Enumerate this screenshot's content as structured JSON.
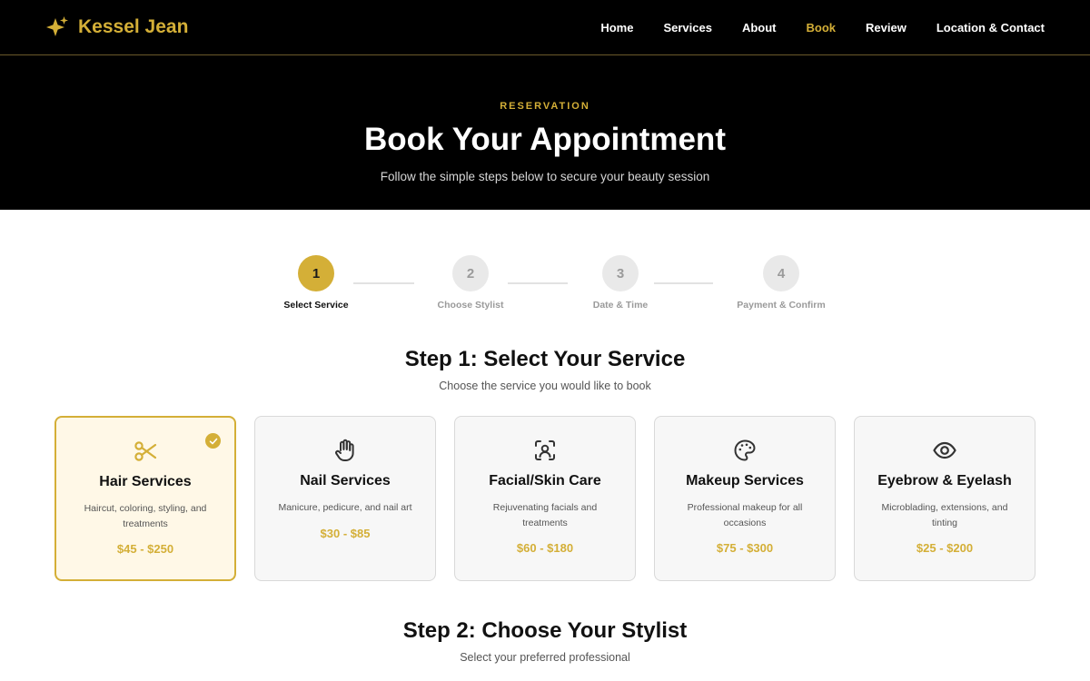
{
  "header": {
    "brand": "Kessel Jean",
    "nav": [
      "Home",
      "Services",
      "About",
      "Book",
      "Review",
      "Location & Contact"
    ],
    "active_nav": "Book"
  },
  "hero": {
    "eyebrow": "RESERVATION",
    "title": "Book Your Appointment",
    "subtitle": "Follow the simple steps below to secure your beauty session"
  },
  "stepper": {
    "steps": [
      {
        "number": "1",
        "label": "Select Service"
      },
      {
        "number": "2",
        "label": "Choose Stylist"
      },
      {
        "number": "3",
        "label": "Date & Time"
      },
      {
        "number": "4",
        "label": "Payment & Confirm"
      }
    ],
    "current_step": 1
  },
  "step1": {
    "title": "Step 1: Select Your Service",
    "subtitle": "Choose the service you would like to book"
  },
  "services": [
    {
      "icon": "scissors-icon",
      "title": "Hair Services",
      "desc": "Haircut, coloring, styling, and treatments",
      "price": "$45 - $250",
      "selected": true
    },
    {
      "icon": "hand-icon",
      "title": "Nail Services",
      "desc": "Manicure, pedicure, and nail art",
      "price": "$30 - $85",
      "selected": false
    },
    {
      "icon": "face-scan-icon",
      "title": "Facial/Skin Care",
      "desc": "Rejuvenating facials and treatments",
      "price": "$60 - $180",
      "selected": false
    },
    {
      "icon": "palette-icon",
      "title": "Makeup Services",
      "desc": "Professional makeup for all occasions",
      "price": "$75 - $300",
      "selected": false
    },
    {
      "icon": "eye-icon",
      "title": "Eyebrow & Eyelash",
      "desc": "Microblading, extensions, and tinting",
      "price": "$25 - $200",
      "selected": false
    }
  ],
  "step2": {
    "title": "Step 2: Choose Your Stylist",
    "subtitle": "Select your preferred professional"
  },
  "colors": {
    "accent": "#d4af37",
    "header_bg": "#000000",
    "selected_card_bg": "#fff8e7"
  }
}
